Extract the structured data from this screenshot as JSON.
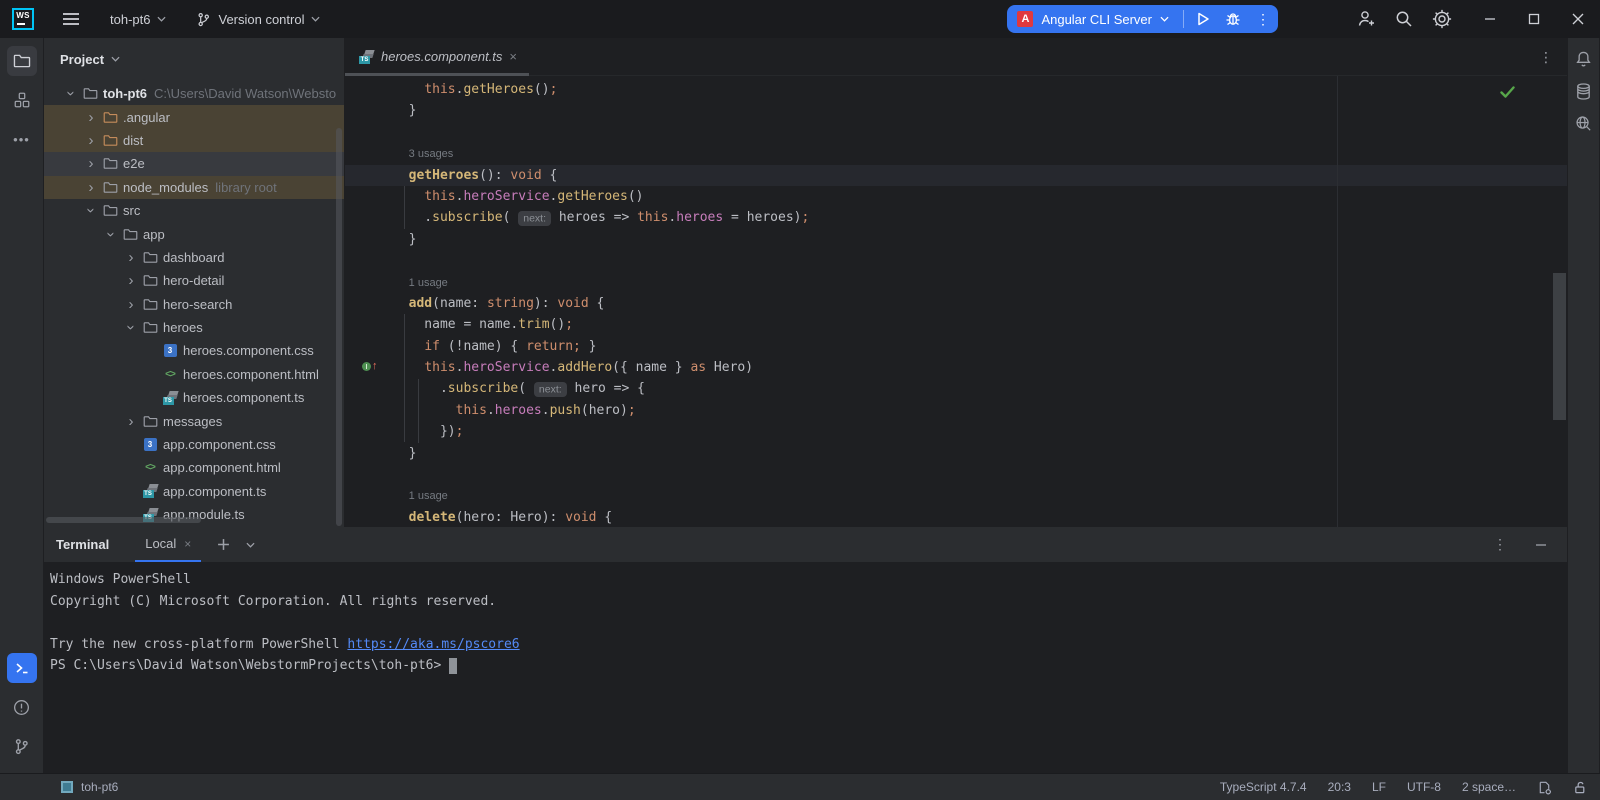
{
  "titlebar": {
    "logo": "WS",
    "project": "toh-pt6",
    "vcs": "Version control",
    "run_config": "Angular CLI Server"
  },
  "project": {
    "header": "Project",
    "tree": [
      {
        "lvl": 0,
        "chev": "open",
        "icon": "folder",
        "label": "toh-pt6",
        "bold": true,
        "extra": "C:\\Users\\David Watson\\Websto"
      },
      {
        "lvl": 1,
        "chev": "closed",
        "icon": "folder-ex",
        "label": ".angular",
        "bg": "ex"
      },
      {
        "lvl": 1,
        "chev": "closed",
        "icon": "folder-ex",
        "label": "dist",
        "bg": "ex"
      },
      {
        "lvl": 1,
        "chev": "closed",
        "icon": "folder",
        "label": "e2e",
        "bg": "sel"
      },
      {
        "lvl": 1,
        "chev": "closed",
        "icon": "folder",
        "label": "node_modules",
        "extra": "library root",
        "bg": "ex"
      },
      {
        "lvl": 1,
        "chev": "open",
        "icon": "folder",
        "label": "src"
      },
      {
        "lvl": 2,
        "chev": "open",
        "icon": "folder",
        "label": "app"
      },
      {
        "lvl": 3,
        "chev": "closed",
        "icon": "folder",
        "label": "dashboard"
      },
      {
        "lvl": 3,
        "chev": "closed",
        "icon": "folder",
        "label": "hero-detail"
      },
      {
        "lvl": 3,
        "chev": "closed",
        "icon": "folder",
        "label": "hero-search"
      },
      {
        "lvl": 3,
        "chev": "open",
        "icon": "folder",
        "label": "heroes"
      },
      {
        "lvl": 4,
        "chev": null,
        "icon": "css",
        "label": "heroes.component.css"
      },
      {
        "lvl": 4,
        "chev": null,
        "icon": "html",
        "label": "heroes.component.html"
      },
      {
        "lvl": 4,
        "chev": null,
        "icon": "ts",
        "label": "heroes.component.ts"
      },
      {
        "lvl": 3,
        "chev": "closed",
        "icon": "folder",
        "label": "messages"
      },
      {
        "lvl": 3,
        "chev": null,
        "icon": "css",
        "label": "app.component.css"
      },
      {
        "lvl": 3,
        "chev": null,
        "icon": "html",
        "label": "app.component.html"
      },
      {
        "lvl": 3,
        "chev": null,
        "icon": "ts",
        "label": "app.component.ts"
      },
      {
        "lvl": 3,
        "chev": null,
        "icon": "ts",
        "label": "app.module.ts"
      }
    ]
  },
  "editor": {
    "tab": {
      "label": "heroes.component.ts"
    },
    "lines": [
      {
        "s": [
          {
            "t": "    "
          },
          {
            "t": "this",
            "c": "kw"
          },
          {
            "t": "."
          },
          {
            "t": "getHeroes",
            "c": "fn"
          },
          {
            "t": "()"
          },
          {
            "t": ";",
            "c": "kw"
          }
        ]
      },
      {
        "s": [
          {
            "t": "  }"
          }
        ]
      },
      {
        "s": []
      },
      {
        "s": [
          {
            "t": "  "
          },
          {
            "t": "3 usages",
            "c": "us"
          }
        ]
      },
      {
        "hl": true,
        "s": [
          {
            "t": "  "
          },
          {
            "t": "getHeroes",
            "c": "fnb"
          },
          {
            "t": "(): "
          },
          {
            "t": "void",
            "c": "kw"
          },
          {
            "t": " {"
          }
        ]
      },
      {
        "s": [
          {
            "t": "    "
          },
          {
            "t": "this",
            "c": "kw"
          },
          {
            "t": "."
          },
          {
            "t": "heroService",
            "c": "fld"
          },
          {
            "t": "."
          },
          {
            "t": "getHeroes",
            "c": "fn"
          },
          {
            "t": "()"
          }
        ]
      },
      {
        "s": [
          {
            "t": "    ."
          },
          {
            "t": "subscribe",
            "c": "fn"
          },
          {
            "t": "( "
          },
          {
            "t": "next:",
            "c": "hint"
          },
          {
            "t": " heroes => "
          },
          {
            "t": "this",
            "c": "kw"
          },
          {
            "t": "."
          },
          {
            "t": "heroes",
            "c": "fld"
          },
          {
            "t": " = heroes)"
          },
          {
            "t": ";",
            "c": "kw"
          }
        ]
      },
      {
        "s": [
          {
            "t": "  }"
          }
        ]
      },
      {
        "s": []
      },
      {
        "s": [
          {
            "t": "  "
          },
          {
            "t": "1 usage",
            "c": "us"
          }
        ]
      },
      {
        "s": [
          {
            "t": "  "
          },
          {
            "t": "add",
            "c": "fnb"
          },
          {
            "t": "(name: "
          },
          {
            "t": "string",
            "c": "kw"
          },
          {
            "t": "): "
          },
          {
            "t": "void",
            "c": "kw"
          },
          {
            "t": " {"
          }
        ]
      },
      {
        "s": [
          {
            "t": "    name = name."
          },
          {
            "t": "trim",
            "c": "fn"
          },
          {
            "t": "()"
          },
          {
            "t": ";",
            "c": "kw"
          }
        ]
      },
      {
        "s": [
          {
            "t": "    "
          },
          {
            "t": "if",
            "c": "kw"
          },
          {
            "t": " (!name) { "
          },
          {
            "t": "return",
            "c": "kw"
          },
          {
            "t": ";",
            "c": "kw"
          },
          {
            "t": " }"
          }
        ]
      },
      {
        "s": [
          {
            "t": "    "
          },
          {
            "t": "this",
            "c": "kw"
          },
          {
            "t": "."
          },
          {
            "t": "heroService",
            "c": "fld"
          },
          {
            "t": "."
          },
          {
            "t": "addHero",
            "c": "fn"
          },
          {
            "t": "({ name } "
          },
          {
            "t": "as",
            "c": "kw"
          },
          {
            "t": " Hero)"
          }
        ]
      },
      {
        "s": [
          {
            "t": "      ."
          },
          {
            "t": "subscribe",
            "c": "fn"
          },
          {
            "t": "( "
          },
          {
            "t": "next:",
            "c": "hint"
          },
          {
            "t": " hero => {"
          }
        ]
      },
      {
        "s": [
          {
            "t": "        "
          },
          {
            "t": "this",
            "c": "kw"
          },
          {
            "t": "."
          },
          {
            "t": "heroes",
            "c": "fld"
          },
          {
            "t": "."
          },
          {
            "t": "push",
            "c": "fn"
          },
          {
            "t": "(hero)"
          },
          {
            "t": ";",
            "c": "kw"
          }
        ]
      },
      {
        "s": [
          {
            "t": "      })"
          },
          {
            "t": ";",
            "c": "kw"
          }
        ]
      },
      {
        "s": [
          {
            "t": "  }"
          }
        ]
      },
      {
        "s": []
      },
      {
        "s": [
          {
            "t": "  "
          },
          {
            "t": "1 usage",
            "c": "us"
          }
        ]
      },
      {
        "s": [
          {
            "t": "  "
          },
          {
            "t": "delete",
            "c": "fnb"
          },
          {
            "t": "(hero: Hero): "
          },
          {
            "t": "void",
            "c": "kw"
          },
          {
            "t": " {"
          }
        ]
      }
    ]
  },
  "terminal": {
    "title": "Terminal",
    "tab": "Local",
    "lines": [
      [
        {
          "t": "Windows PowerShell"
        }
      ],
      [
        {
          "t": "Copyright (C) Microsoft Corporation. All rights reserved."
        }
      ],
      [],
      [
        {
          "t": "Try the new cross-platform PowerShell "
        },
        {
          "t": "https://aka.ms/pscore6",
          "c": "lnk"
        }
      ],
      [
        {
          "t": "PS C:\\Users\\David Watson\\WebstormProjects\\toh-pt6> "
        },
        {
          "t": " ",
          "c": "cur"
        }
      ]
    ]
  },
  "statusbar": {
    "project": "toh-pt6",
    "items": [
      {
        "label": "TypeScript 4.7.4",
        "name": "file-type-widget"
      },
      {
        "label": "20:3",
        "name": "caret-position-widget"
      },
      {
        "label": "LF",
        "name": "line-separator-widget"
      },
      {
        "label": "UTF-8",
        "name": "encoding-widget"
      },
      {
        "label": "2 space…",
        "name": "indent-widget"
      }
    ]
  },
  "colors": {
    "accent": "#3574F0",
    "angular_red": "#E0393F",
    "excluded_row": "#4A4334",
    "link": "#548AF7"
  }
}
